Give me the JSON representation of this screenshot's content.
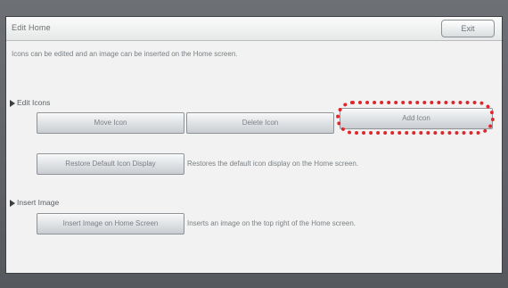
{
  "window": {
    "title": "Edit Home",
    "exit_label": "Exit"
  },
  "description": "Icons can be edited and an image can be inserted on the Home screen.",
  "edit_icons": {
    "heading": "Edit Icons",
    "move_label": "Move Icon",
    "delete_label": "Delete Icon",
    "add_label": "Add Icon",
    "restore_label": "Restore Default Icon Display",
    "restore_hint": "Restores the default icon display on the Home screen."
  },
  "insert_image": {
    "heading": "Insert Image",
    "button_label": "Insert Image on Home Screen",
    "hint": "Inserts an image on the top right of the Home screen."
  },
  "highlight_color": "#e0262a"
}
